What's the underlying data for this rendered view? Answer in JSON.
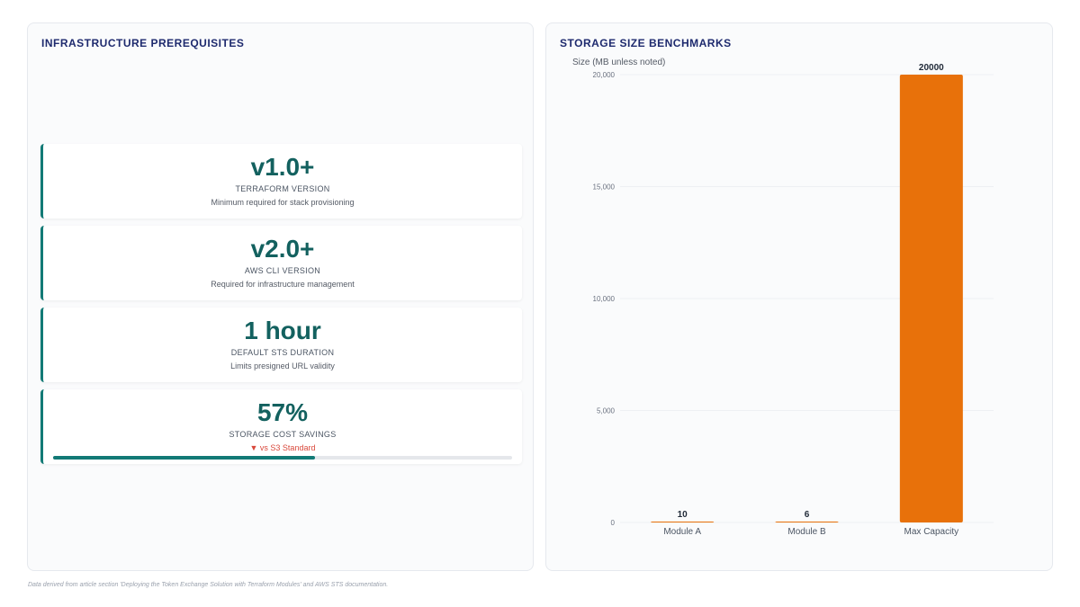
{
  "left_panel": {
    "title": "INFRASTRUCTURE PREREQUISITES",
    "cards": [
      {
        "value": "v1.0+",
        "label": "TERRAFORM VERSION",
        "description": "Minimum required for stack provisioning"
      },
      {
        "value": "v2.0+",
        "label": "AWS CLI VERSION",
        "description": "Required for infrastructure management"
      },
      {
        "value": "1 hour",
        "label": "DEFAULT STS DURATION",
        "description": "Limits presigned URL validity"
      },
      {
        "value": "57%",
        "label": "STORAGE COST SAVINGS",
        "description": "▼ vs S3 Standard",
        "progress": 57
      }
    ]
  },
  "right_panel": {
    "title": "STORAGE SIZE BENCHMARKS"
  },
  "chart_data": {
    "type": "bar",
    "ylabel": "Size (MB unless noted)",
    "categories": [
      "Module A",
      "Module B",
      "Max Capacity"
    ],
    "values": [
      10,
      6,
      20000
    ],
    "data_labels": [
      "10",
      "6",
      "20000"
    ],
    "ylim": [
      0,
      20000
    ],
    "yticks": [
      0,
      5000,
      10000,
      15000,
      20000
    ],
    "ytick_labels": [
      "0",
      "5,000",
      "10,000",
      "15,000",
      "20,000"
    ],
    "grid": true,
    "bar_color": "#e8710a"
  },
  "footnote": "Data derived from article section 'Deploying the Token Exchange Solution with Terraform Modules' and AWS STS documentation.",
  "colors": {
    "accent": "#127a76",
    "title": "#1e2a6e",
    "bar": "#e8710a",
    "negative": "#d9483b"
  }
}
